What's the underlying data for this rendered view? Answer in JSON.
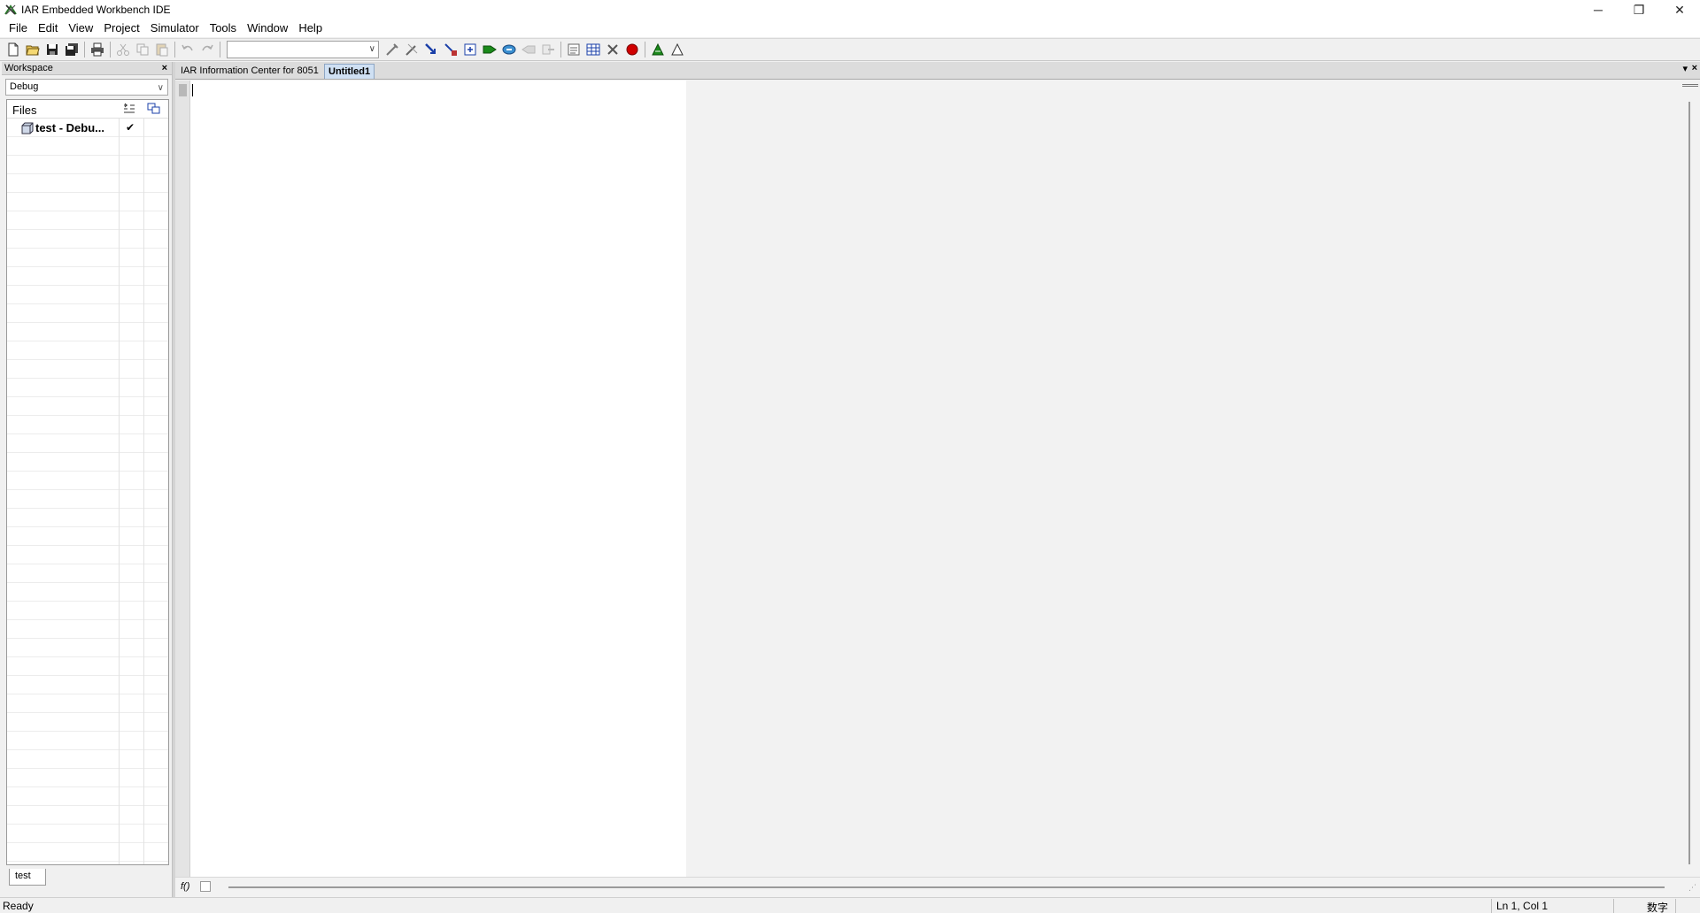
{
  "window": {
    "title": "IAR Embedded Workbench IDE",
    "minimize_glyph": "─",
    "restore_glyph": "❐",
    "close_glyph": "✕"
  },
  "menu": [
    "File",
    "Edit",
    "View",
    "Project",
    "Simulator",
    "Tools",
    "Window",
    "Help"
  ],
  "toolbar": {
    "search_combo_value": ""
  },
  "workspace": {
    "title": "Workspace",
    "close_glyph": "×",
    "configuration": "Debug",
    "files_header": "Files",
    "project_label": "test - Debu...",
    "project_check": "✔",
    "tab_label": "test"
  },
  "editor": {
    "tabs": [
      "IAR Information Center for 8051",
      "Untitled1"
    ],
    "active_tab": "Untitled1",
    "dropdown_glyph": "▾",
    "close_glyph": "×",
    "fx_label": "f()"
  },
  "status": {
    "ready": "Ready",
    "position": "Ln 1, Col 1",
    "ime": "数字"
  },
  "colors": {
    "active_tab_bg": "#cfe0f3",
    "editor_bg": "#ffffff",
    "breakpoint_red": "#d00000",
    "run_green": "#1a8a1a"
  }
}
